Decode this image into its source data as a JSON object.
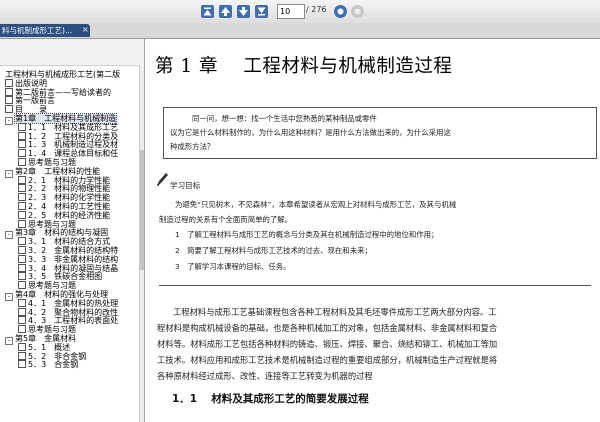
{
  "toolbar": {
    "page_value": "10",
    "page_total": "/ 276",
    "icons": [
      "first-page-icon",
      "prev-page-icon",
      "next-page-icon",
      "last-page-icon",
      "zoom-in-icon",
      "zoom-out-icon"
    ]
  },
  "tab": {
    "title": "料与机制成形工艺)..."
  },
  "sidebar": {
    "items": [
      {
        "level": 0,
        "label": "工程材料与机械成形工艺(第二版"
      },
      {
        "level": 1,
        "label": "出版说明"
      },
      {
        "level": 1,
        "label": "第二版前言——写给读者的"
      },
      {
        "level": 1,
        "label": "第一版前言"
      },
      {
        "level": 1,
        "label": "目　　录"
      },
      {
        "level": 1,
        "label": "第1章　工程材料与机械制造",
        "selected": true,
        "toggle": "-"
      },
      {
        "level": 2,
        "label": "1．1　材料及其成形工艺"
      },
      {
        "level": 2,
        "label": "1．2　工程材料的分类及"
      },
      {
        "level": 2,
        "label": "1．3　机械制造过程及材"
      },
      {
        "level": 2,
        "label": "1．4　课程总体目标和任"
      },
      {
        "level": 2,
        "label": "思考题与习题"
      },
      {
        "level": 1,
        "label": "第2章　工程材料的性能",
        "toggle": "-"
      },
      {
        "level": 2,
        "label": "2．1　材料的力学性能"
      },
      {
        "level": 2,
        "label": "2．2　材料的物理性能"
      },
      {
        "level": 2,
        "label": "2．3　材料的化学性能"
      },
      {
        "level": 2,
        "label": "2．4　材料的工艺性能"
      },
      {
        "level": 2,
        "label": "2．5　材料的经济性能"
      },
      {
        "level": 2,
        "label": "思考题与习题"
      },
      {
        "level": 1,
        "label": "第3章　材料的结构与凝固",
        "toggle": "-"
      },
      {
        "level": 2,
        "label": "3．1　材料的结合方式"
      },
      {
        "level": 2,
        "label": "3．2　金属材料的结构特"
      },
      {
        "level": 2,
        "label": "3．3　非金属材料的结构"
      },
      {
        "level": 2,
        "label": "3．4　材料的凝固与结晶"
      },
      {
        "level": 2,
        "label": "3．5　铁碳合金相图"
      },
      {
        "level": 2,
        "label": "思考题与习题"
      },
      {
        "level": 1,
        "label": "第4章　材料的强化与处理",
        "toggle": "-"
      },
      {
        "level": 2,
        "label": "4．1　金属材料的热处理"
      },
      {
        "level": 2,
        "label": "4．2　聚合物材料的改性"
      },
      {
        "level": 2,
        "label": "4．3　工程材料的表面处"
      },
      {
        "level": 2,
        "label": "思考题与习题"
      },
      {
        "level": 1,
        "label": "第5章　金属材料",
        "toggle": "-"
      },
      {
        "level": 2,
        "label": "5．1　概述"
      },
      {
        "level": 2,
        "label": "5．2　非合金钢"
      },
      {
        "level": 2,
        "label": "5．3　合金钢"
      }
    ]
  },
  "document": {
    "chapter_title": "第 1 章　 工程材料与机械制造过程",
    "intro": {
      "line1": "同一问，想一想：找一个生活中您熟悉的某种制品或零件",
      "line2": "议为它是什么材料制作的，为什么用这种材料？是用什么方法做出来的，为什么采用这",
      "line3": "种成形方法？"
    },
    "goals_title": "学习目标",
    "goals_intro_1": "为避免“只见树木，不见森林”，本章希望读者从宏观上对材料与成形工艺，及其与机械",
    "goals_intro_2": "制造过程的关系有个全面而简单的了解。",
    "goals": [
      "1　了解工程材料与成形工艺的概念与分类及其在机械制造过程中的地位和作用；",
      "2　简要了解工程材料与成形工艺技术的过去、现在和未来；",
      "3　了解学习本课程的目标、任务。"
    ],
    "body": [
      "工程材料与成形工艺基础课程包含各种工程材料及其毛坯零件成形工艺两大部分内容。工",
      "程材料是构成机械设备的基础，也是各种机械加工的对象，包括金属材料、非金属材料和复合",
      "材料等。材料成形工艺包括各种材料的铸造、锻压、焊接、聚合、烧结和铆工、机械加工等加",
      "工技术。材料应用和成形工艺技术是机械制造过程的重要组成部分，机械制造生产过程就是将",
      "各种原材料经过成形、改性、连接等工艺转变为机器的过程"
    ],
    "section_title": "1．1　 材料及其成形工艺的简要发展过程"
  }
}
